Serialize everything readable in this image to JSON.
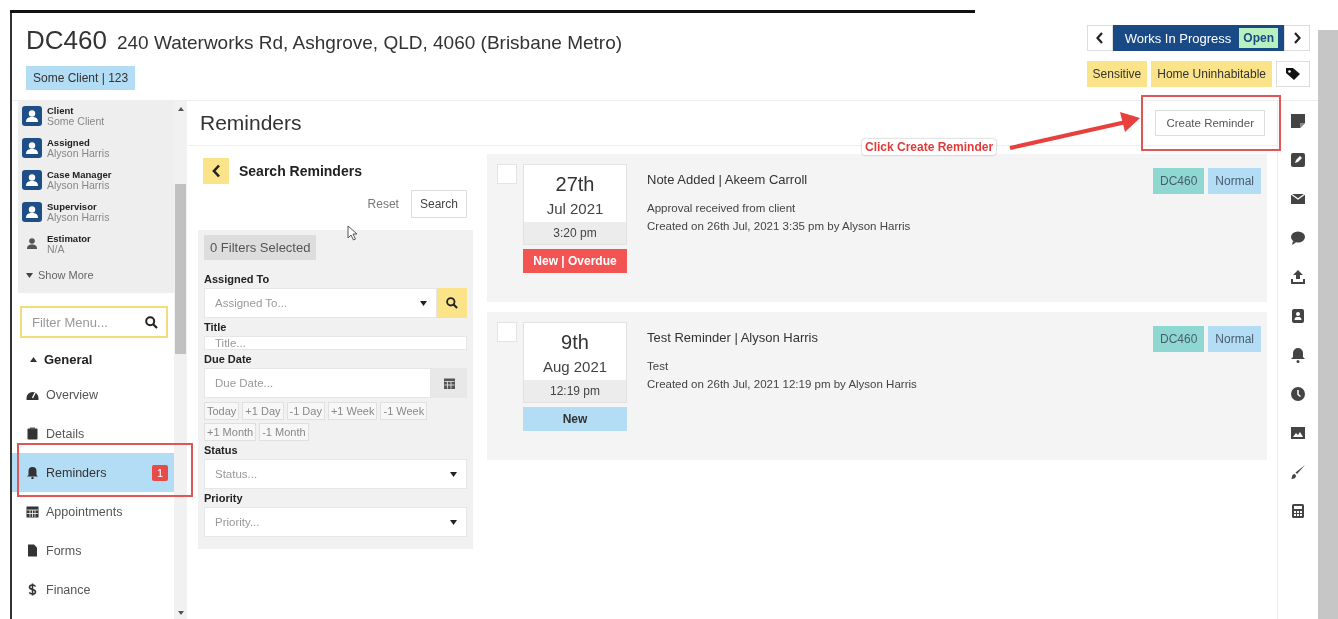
{
  "header": {
    "job_number": "DC460",
    "address": "240 Waterworks Rd, Ashgrove, QLD, 4060 (Brisbane Metro)",
    "client_badge": "Some Client | 123",
    "workflow": {
      "status": "Works In Progress",
      "state": "Open"
    },
    "tags": [
      "Sensitive",
      "Home Uninhabitable"
    ]
  },
  "sidebar": {
    "people": [
      {
        "role": "Client",
        "name": "Some Client",
        "kind": "avatar"
      },
      {
        "role": "Assigned",
        "name": "Alyson Harris",
        "kind": "avatar"
      },
      {
        "role": "Case Manager",
        "name": "Alyson Harris",
        "kind": "avatar"
      },
      {
        "role": "Supervisor",
        "name": "Alyson Harris",
        "kind": "avatar"
      },
      {
        "role": "Estimator",
        "name": "N/A",
        "kind": "plain"
      }
    ],
    "show_more": "Show More",
    "filter": {
      "placeholder": "Filter Menu..."
    },
    "section": {
      "label": "General",
      "expanded": true
    },
    "items": [
      {
        "label": "Overview",
        "selected": false
      },
      {
        "label": "Details",
        "selected": false
      },
      {
        "label": "Reminders",
        "selected": true,
        "badge": "1"
      },
      {
        "label": "Appointments",
        "selected": false
      },
      {
        "label": "Forms",
        "selected": false
      },
      {
        "label": "Finance",
        "selected": false
      }
    ]
  },
  "page": {
    "title": "Reminders",
    "create_button": "Create Reminder"
  },
  "search": {
    "title": "Search Reminders",
    "reset": "Reset",
    "search": "Search",
    "filters_selected": "0 Filters Selected",
    "fields": [
      {
        "label": "Assigned To",
        "placeholder": "Assigned To...",
        "kind": "lookup"
      },
      {
        "label": "Title",
        "placeholder": "Title...",
        "kind": "text"
      },
      {
        "label": "Due Date",
        "placeholder": "Due Date...",
        "kind": "date",
        "shortcuts": [
          "Today",
          "+1 Day",
          "-1 Day",
          "+1 Week",
          "-1 Week",
          "+1 Month",
          "-1 Month"
        ]
      },
      {
        "label": "Status",
        "placeholder": "Status...",
        "kind": "select"
      },
      {
        "label": "Priority",
        "placeholder": "Priority...",
        "kind": "select"
      }
    ]
  },
  "reminders": [
    {
      "checked": false,
      "day": "27th",
      "month": "Jul 2021",
      "time": "3:20 pm",
      "status": "New | Overdue",
      "kind": "overdue",
      "title": "Note Added | Akeem Carroll",
      "body": "Approval received from client",
      "created": "Created on 26th Jul, 2021 3:35 pm by Alyson Harris",
      "tags": [
        {
          "label": "DC460",
          "color": "#8fd8d2"
        },
        {
          "label": "Normal",
          "color": "#b3dcf5"
        }
      ]
    },
    {
      "checked": false,
      "day": "9th",
      "month": "Aug 2021",
      "time": "12:19 pm",
      "status": "New",
      "kind": "new",
      "title": "Test Reminder | Alyson Harris",
      "body": "Test",
      "created": "Created on 26th Jul, 2021 12:19 pm by Alyson Harris",
      "tags": [
        {
          "label": "DC460",
          "color": "#8fd8d2"
        },
        {
          "label": "Normal",
          "color": "#b3dcf5"
        }
      ]
    }
  ],
  "annotation": {
    "callout": "Click Create Reminder"
  }
}
